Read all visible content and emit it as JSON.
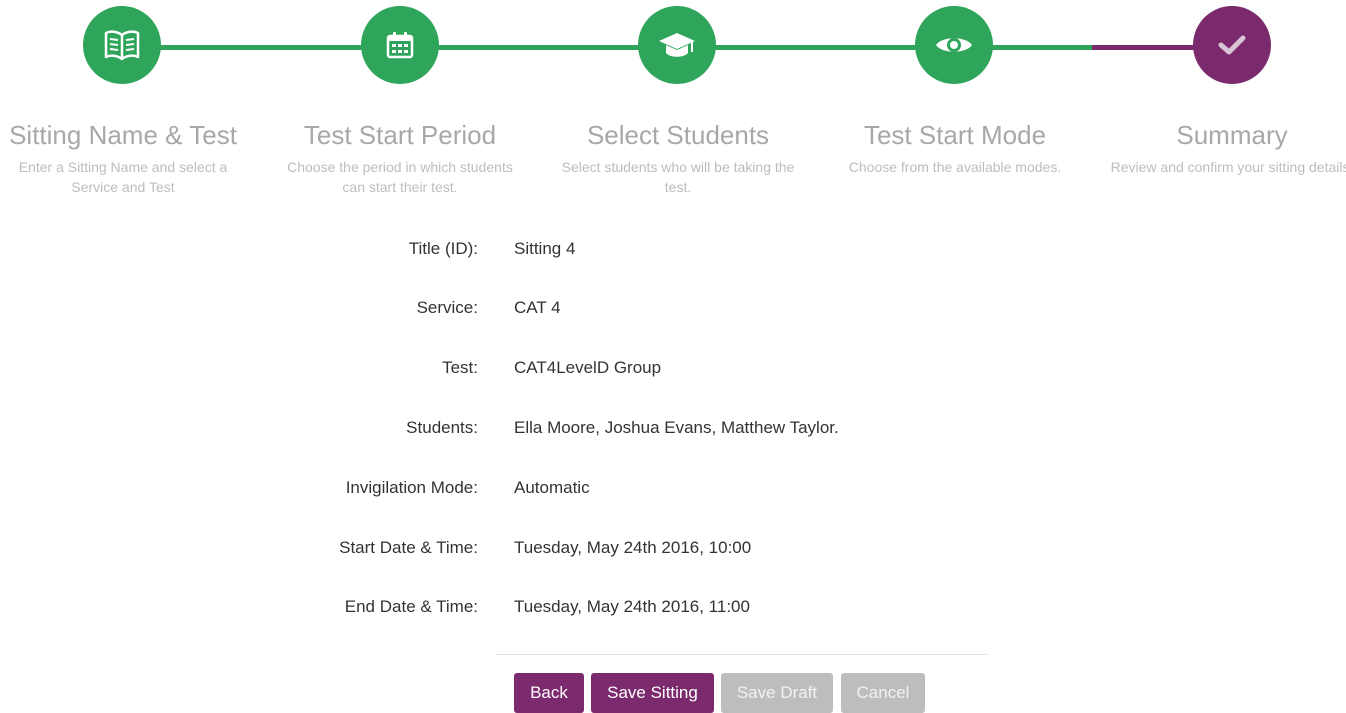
{
  "colors": {
    "step_complete": "#2ea55a",
    "step_active": "#7c2a6e",
    "button_primary": "#7c2a6e",
    "button_disabled": "#bdbdbd"
  },
  "steps": [
    {
      "icon": "open-book-icon",
      "title": "Sitting Name & Test",
      "description": "Enter a Sitting Name and select a Service and Test"
    },
    {
      "icon": "calendar-icon",
      "title": "Test Start Period",
      "description": "Choose the period in which students can start their test."
    },
    {
      "icon": "graduation-cap-icon",
      "title": "Select Students",
      "description": "Select students who will be taking the test."
    },
    {
      "icon": "eye-icon",
      "title": "Test Start Mode",
      "description": "Choose from the available modes."
    },
    {
      "icon": "checkmark-icon",
      "title": "Summary",
      "description": "Review and confirm your sitting details."
    }
  ],
  "summary": {
    "title": {
      "label": "Title (ID):",
      "value": "Sitting 4"
    },
    "service": {
      "label": "Service:",
      "value": "CAT 4"
    },
    "test": {
      "label": "Test:",
      "value": "CAT4LevelD Group"
    },
    "students": {
      "label": "Students:",
      "value": "Ella Moore, Joshua Evans, Matthew Taylor."
    },
    "invigilation": {
      "label": "Invigilation Mode:",
      "value": "Automatic"
    },
    "start": {
      "label": "Start Date & Time:",
      "value": "Tuesday, May 24th 2016, 10:00"
    },
    "end": {
      "label": "End Date & Time:",
      "value": "Tuesday, May 24th 2016, 11:00"
    }
  },
  "buttons": {
    "back": "Back",
    "save_sitting": "Save Sitting",
    "save_draft": "Save Draft",
    "cancel": "Cancel"
  }
}
